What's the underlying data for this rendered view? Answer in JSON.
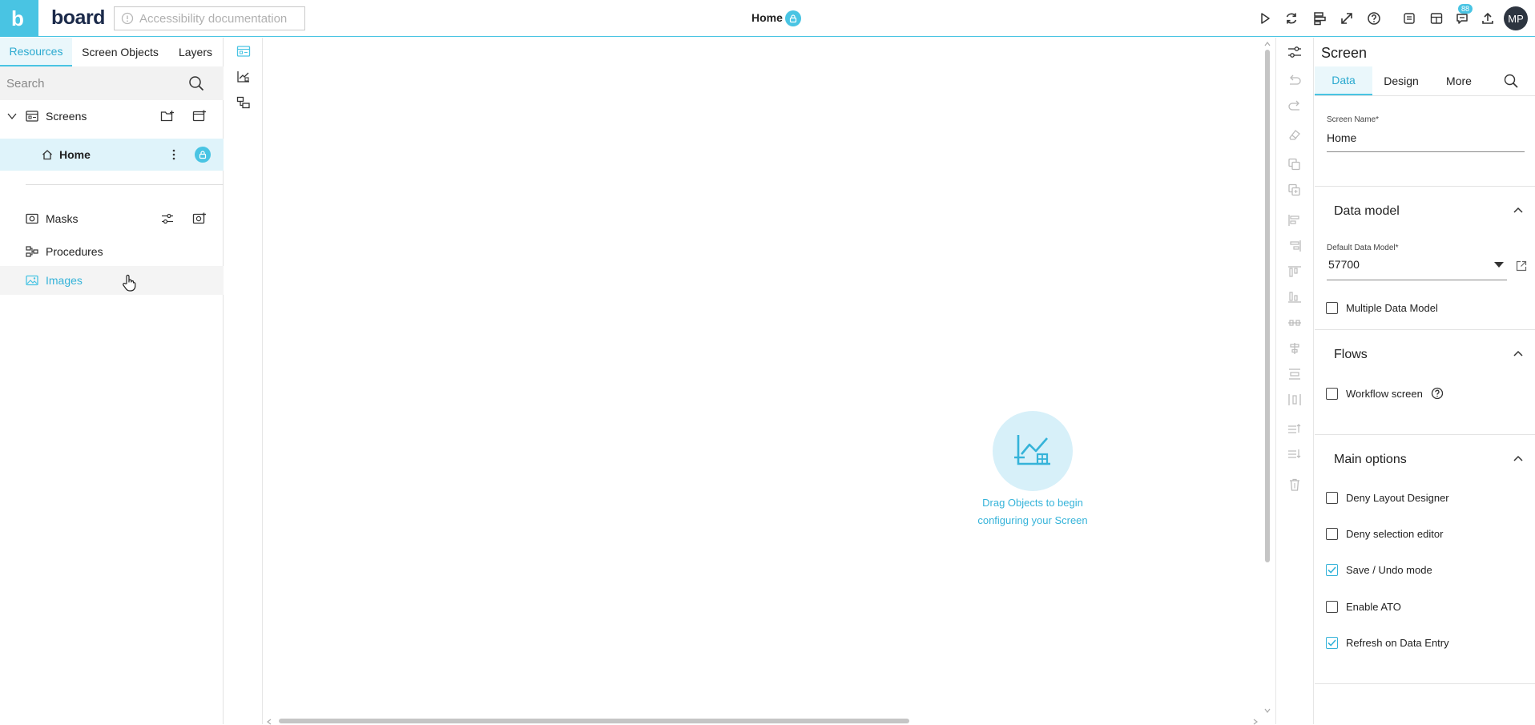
{
  "topbar": {
    "logo_text": "board",
    "accessibility_button": "Accessibility documentation",
    "screen_title": "Home",
    "notification_count": "88",
    "avatar_initials": "MP"
  },
  "left_panel": {
    "tabs": [
      {
        "label": "Resources",
        "active": true
      },
      {
        "label": "Screen Objects",
        "active": false
      },
      {
        "label": "Layers",
        "active": false
      }
    ],
    "search": {
      "placeholder": "Search",
      "value": ""
    },
    "screens_label": "Screens",
    "home_label": "Home",
    "masks_label": "Masks",
    "procedures_label": "Procedures",
    "images_label": "Images"
  },
  "canvas": {
    "drop_hint_line1": "Drag Objects to begin",
    "drop_hint_line2": "configuring your Screen"
  },
  "properties": {
    "title": "Screen",
    "tabs": [
      {
        "label": "Data",
        "active": true
      },
      {
        "label": "Design",
        "active": false
      },
      {
        "label": "More",
        "active": false
      }
    ],
    "screen_name_label": "Screen Name*",
    "screen_name_value": "Home",
    "data_model_section": "Data model",
    "default_data_model_label": "Default Data Model*",
    "default_data_model_value": "57700",
    "multiple_data_model": {
      "label": "Multiple Data Model",
      "checked": false
    },
    "flows_section": "Flows",
    "workflow_screen": {
      "label": "Workflow screen",
      "checked": false
    },
    "main_options_section": "Main options",
    "main_options": [
      {
        "label": "Deny Layout Designer",
        "checked": false
      },
      {
        "label": "Deny selection editor",
        "checked": false
      },
      {
        "label": "Save / Undo mode",
        "checked": true
      },
      {
        "label": "Enable ATO",
        "checked": false
      },
      {
        "label": "Refresh on Data Entry",
        "checked": true
      }
    ]
  },
  "colors": {
    "accent": "#49c4e3",
    "accent_text": "#35b3d9",
    "selected_row": "#dff3fa",
    "dark_text": "#222222"
  }
}
